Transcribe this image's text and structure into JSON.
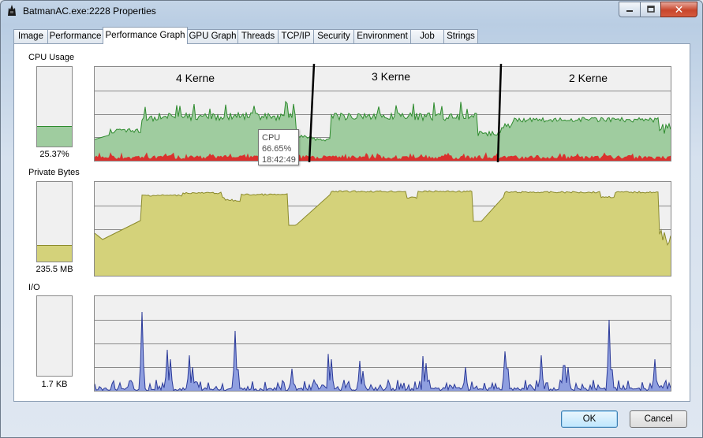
{
  "window": {
    "title": "BatmanAC.exe:2228 Properties"
  },
  "tabs": [
    {
      "label": "Image"
    },
    {
      "label": "Performance"
    },
    {
      "label": "Performance Graph",
      "active": true
    },
    {
      "label": "GPU Graph"
    },
    {
      "label": "Threads"
    },
    {
      "label": "TCP/IP"
    },
    {
      "label": "Security"
    },
    {
      "label": "Environment"
    },
    {
      "label": "Job"
    },
    {
      "label": "Strings"
    }
  ],
  "cpu": {
    "label": "CPU Usage",
    "value_text": "25.37%",
    "gauge_fraction": 0.2537,
    "segment_labels": [
      "4 Kerne",
      "3 Kerne",
      "2 Kerne"
    ],
    "tooltip": {
      "title": "CPU",
      "value": "66.65%",
      "time": "18:42:49"
    },
    "color_total": "#9fcc9f",
    "color_total_line": "#2e8b2e",
    "color_kernel": "#e02020"
  },
  "private_bytes": {
    "label": "Private Bytes",
    "value_text": "235.5 MB",
    "color_fill": "#d4d27a",
    "color_line": "#8b8a2c"
  },
  "io": {
    "label": "I/O",
    "value_text": "1.7  KB",
    "color_fill": "#8f9fe0",
    "color_line": "#2b3a99"
  },
  "buttons": {
    "ok": "OK",
    "cancel": "Cancel"
  }
}
